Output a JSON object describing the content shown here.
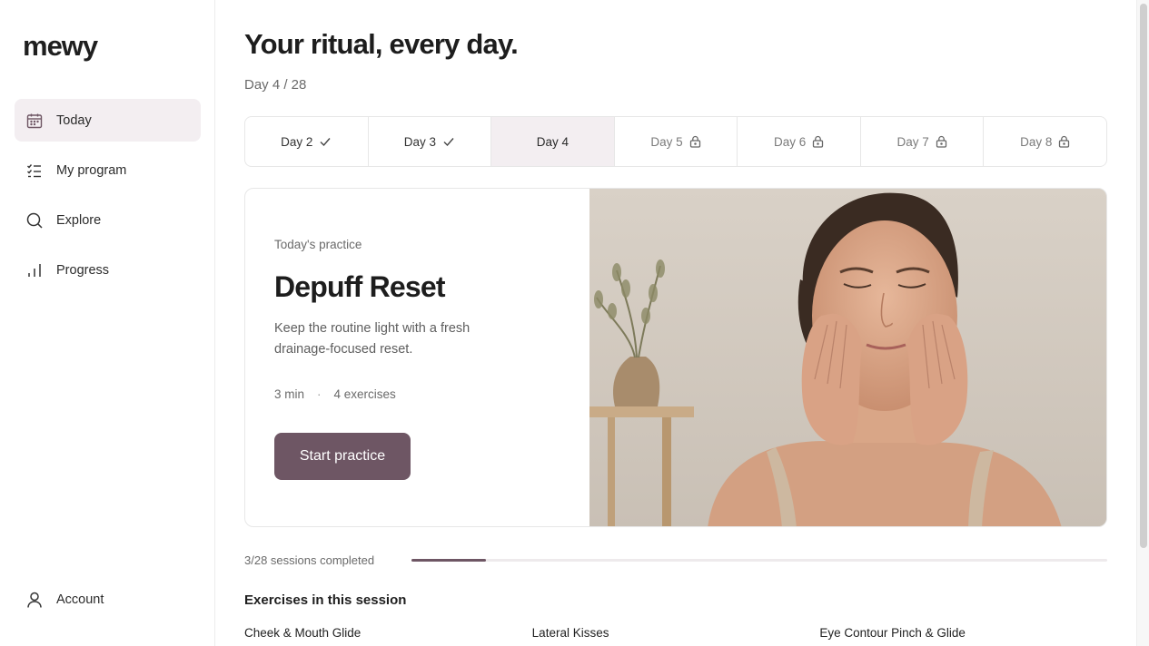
{
  "app": {
    "logo": "mewy"
  },
  "sidebar": {
    "items": [
      {
        "label": "Today",
        "icon": "calendar-icon",
        "active": true
      },
      {
        "label": "My program",
        "icon": "checklist-icon",
        "active": false
      },
      {
        "label": "Explore",
        "icon": "search-icon",
        "active": false
      },
      {
        "label": "Progress",
        "icon": "bar-chart-icon",
        "active": false
      }
    ],
    "account": {
      "label": "Account",
      "icon": "user-icon"
    }
  },
  "header": {
    "title": "Your ritual, every day.",
    "day_count": "Day 4 / 28"
  },
  "tabs": [
    {
      "label": "Day 2",
      "state": "completed",
      "icon": "check-icon"
    },
    {
      "label": "Day 3",
      "state": "completed",
      "icon": "check-icon"
    },
    {
      "label": "Day 4",
      "state": "current",
      "icon": ""
    },
    {
      "label": "Day 5",
      "state": "locked",
      "icon": "lock-icon"
    },
    {
      "label": "Day 6",
      "state": "locked",
      "icon": "lock-icon"
    },
    {
      "label": "Day 7",
      "state": "locked",
      "icon": "lock-icon"
    },
    {
      "label": "Day 8",
      "state": "locked",
      "icon": "lock-icon"
    }
  ],
  "practice": {
    "eyebrow": "Today's practice",
    "title": "Depuff Reset",
    "description": "Keep the routine light with a fresh drainage-focused reset.",
    "duration": "3 min",
    "separator": "·",
    "exercises_count": "4 exercises",
    "cta_label": "Start practice",
    "photo_icon": "face-massage-photo"
  },
  "progress": {
    "label": "3/28 sessions completed",
    "completed": 3,
    "total": 28
  },
  "session": {
    "title": "Exercises in this session",
    "exercises": [
      "Cheek & Mouth Glide",
      "Lateral Kisses",
      "Eye Contour Pinch & Glide"
    ]
  },
  "colors": {
    "accent": "#6e5664",
    "active_bg": "#f3eef1",
    "border": "#e7e7e7"
  }
}
